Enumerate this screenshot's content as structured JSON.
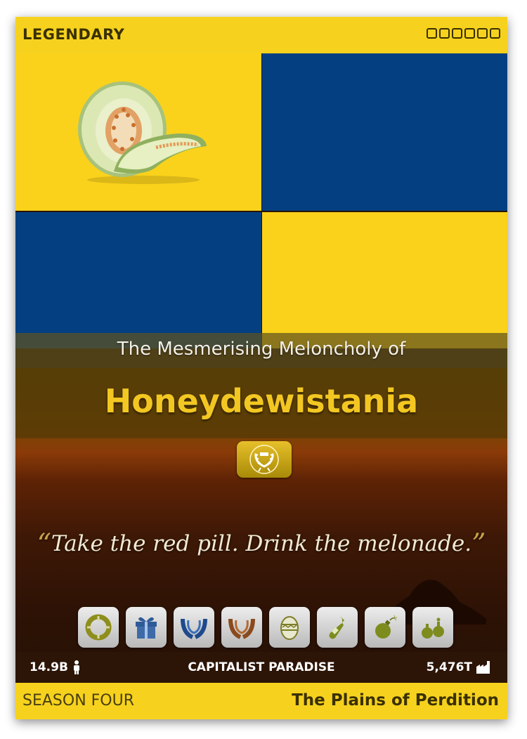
{
  "header": {
    "rarity": "LEGENDARY",
    "slot_count": 6
  },
  "flag": {
    "colors": {
      "yellow": "#fad21c",
      "blue": "#043f82"
    },
    "emblem": "honeydew-melon"
  },
  "nation": {
    "pretitle": "The Mesmerising Meloncholy of",
    "name": "Honeydewistania",
    "badge_icon": "laurel-wreath-icon",
    "motto": "Take the red pill. Drink the melonade.",
    "open_quote": "“",
    "close_quote": "”"
  },
  "badges": [
    "life-ring-icon",
    "gift-icon",
    "blue-wreath-icon",
    "bronze-wreath-icon",
    "easter-egg-icon",
    "bottle-icon",
    "bomb-icon",
    "potions-icon"
  ],
  "stats": {
    "population": "14.9B",
    "classification": "CAPITALIST PARADISE",
    "industry": "5,476T"
  },
  "footer": {
    "season": "SEASON FOUR",
    "region": "The Plains of Perdition"
  }
}
